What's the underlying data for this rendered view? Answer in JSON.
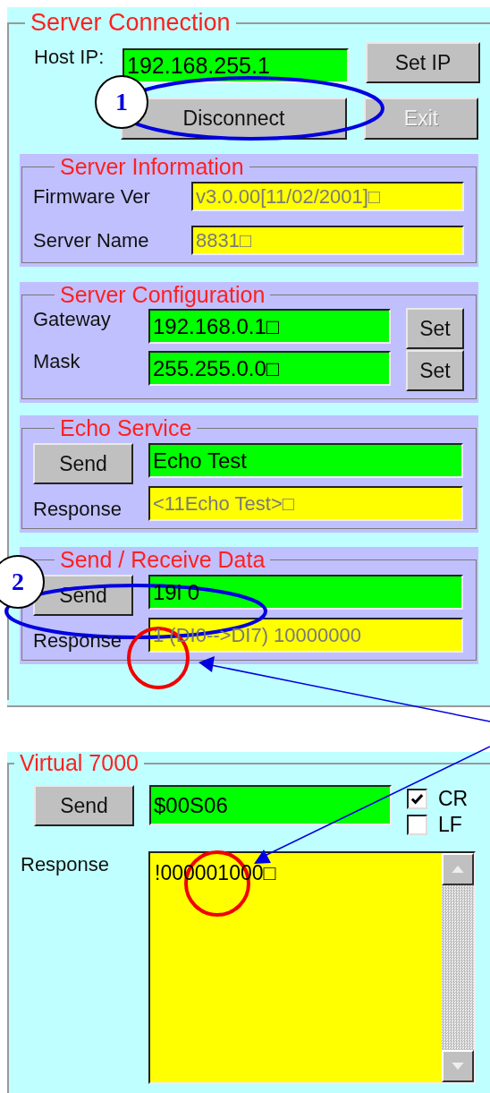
{
  "server_connection": {
    "title": "Server Connection",
    "host_ip": {
      "label": "Host IP:",
      "value": "192.168.255.1"
    },
    "buttons": [
      {
        "label": "Set IP",
        "disabled": false
      },
      {
        "label": "Disconnect",
        "disabled": false
      },
      {
        "label": "Exit",
        "disabled": true
      }
    ],
    "groups": [
      {
        "title": "Server Information",
        "kind": "info",
        "rows": [
          {
            "label": "Firmware Ver",
            "value": "v3.0.00[11/02/2001]□",
            "readonly": true
          },
          {
            "label": "Server Name",
            "value": "8831□",
            "readonly": true
          }
        ]
      },
      {
        "title": "Server Configuration",
        "kind": "config",
        "rows": [
          {
            "label": "Gateway",
            "value": "192.168.0.1□",
            "readonly": false,
            "button": "Set"
          },
          {
            "label": "Mask",
            "value": "255.255.0.0□",
            "readonly": false,
            "button": "Set"
          }
        ]
      },
      {
        "title": "Echo Service",
        "kind": "io",
        "button": "Send",
        "input": {
          "value": "Echo Test",
          "readonly": false
        },
        "response": {
          "label": "Response",
          "value": "<11Echo Test>□",
          "readonly": true
        }
      },
      {
        "title": "Send / Receive Data",
        "kind": "io",
        "button": "Send",
        "input": {
          "value": "19i 0",
          "readonly": false
        },
        "response": {
          "label": "Response",
          "value": "1 (DI0-->DI7) 10000000",
          "readonly": true
        }
      }
    ]
  },
  "virtual_7000": {
    "title": "Virtual 7000",
    "button": "Send",
    "input": {
      "value": "$00S06",
      "readonly": false
    },
    "options": [
      {
        "label": "CR",
        "checked": true
      },
      {
        "label": "LF",
        "checked": false
      }
    ],
    "response": {
      "label": "Response",
      "value": "!000001000□"
    }
  },
  "annotations": {
    "badges": [
      {
        "text": "1"
      },
      {
        "text": "2"
      }
    ]
  }
}
